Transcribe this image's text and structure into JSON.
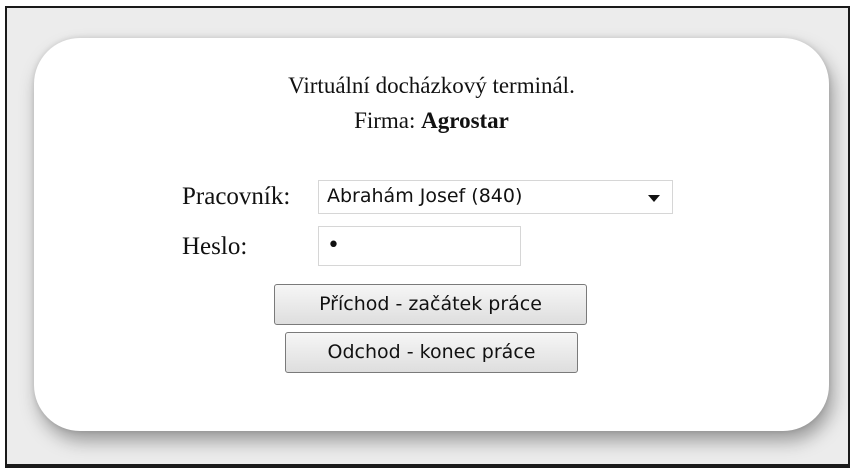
{
  "header": {
    "title": "Virtuální docházkový terminál.",
    "company_label": "Firma:",
    "company_name": "Agrostar"
  },
  "form": {
    "employee_label": "Pracovník:",
    "employee_selected": "Abrahám Josef (840)",
    "password_label": "Heslo:",
    "password_value": "•"
  },
  "actions": {
    "arrive_label": "Příchod - začátek práce",
    "leave_label": "Odchod - konec práce"
  }
}
